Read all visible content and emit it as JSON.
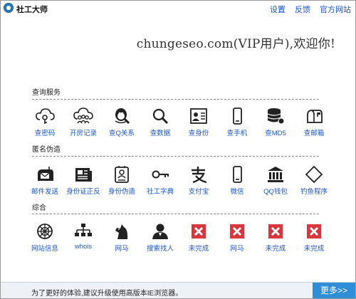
{
  "app": {
    "title": "社工大师"
  },
  "top_links": {
    "settings": "设置",
    "feedback": "反馈",
    "website": "官方网站"
  },
  "welcome": "chungeseo.com(VIP用户),欢迎你!",
  "sections": [
    {
      "title": "查询服务",
      "items": [
        {
          "label": "查密码",
          "icon": "cloud-key-icon"
        },
        {
          "label": "开房记录",
          "icon": "cloud-people-icon"
        },
        {
          "label": "查Q关系",
          "icon": "qq-search-icon"
        },
        {
          "label": "查数据",
          "icon": "magnifier-icon"
        },
        {
          "label": "查身份",
          "icon": "id-card-icon"
        },
        {
          "label": "查手机",
          "icon": "phone-icon"
        },
        {
          "label": "查MD5",
          "icon": "database-icon"
        },
        {
          "label": "查邮箱",
          "icon": "mailbox-icon"
        }
      ]
    },
    {
      "title": "匿名伪造",
      "items": [
        {
          "label": "邮件发送",
          "icon": "mailbox-send-icon"
        },
        {
          "label": "身份证正反",
          "icon": "newspaper-icon"
        },
        {
          "label": "身份伪造",
          "icon": "id-badge-icon"
        },
        {
          "label": "社工字典",
          "icon": "key-icon"
        },
        {
          "label": "支付宝",
          "icon": "alipay-icon"
        },
        {
          "label": "微信",
          "icon": "smartphone-icon"
        },
        {
          "label": "QQ钱包",
          "icon": "bank-icon"
        },
        {
          "label": "钓鱼程序",
          "icon": "diamond-icon"
        }
      ]
    },
    {
      "title": "综合",
      "items": [
        {
          "label": "网站信息",
          "icon": "globe-icon"
        },
        {
          "label": "whois",
          "icon": "network-tree-icon"
        },
        {
          "label": "网马",
          "icon": "horse-icon"
        },
        {
          "label": "搜索找人",
          "icon": "person-icon"
        },
        {
          "label": "未完成",
          "icon": "red-x-icon"
        },
        {
          "label": "网马",
          "icon": "red-x-icon"
        },
        {
          "label": "未完成",
          "icon": "red-x-icon"
        },
        {
          "label": "未完成",
          "icon": "red-x-icon"
        }
      ]
    }
  ],
  "bottom": {
    "note": "为了更好的体验,建议升级使用高版本IE浏览器。",
    "more": "更多>>"
  },
  "colors": {
    "link": "#1a56c8",
    "accent": "#2f8fd6",
    "error": "#d9363e"
  }
}
